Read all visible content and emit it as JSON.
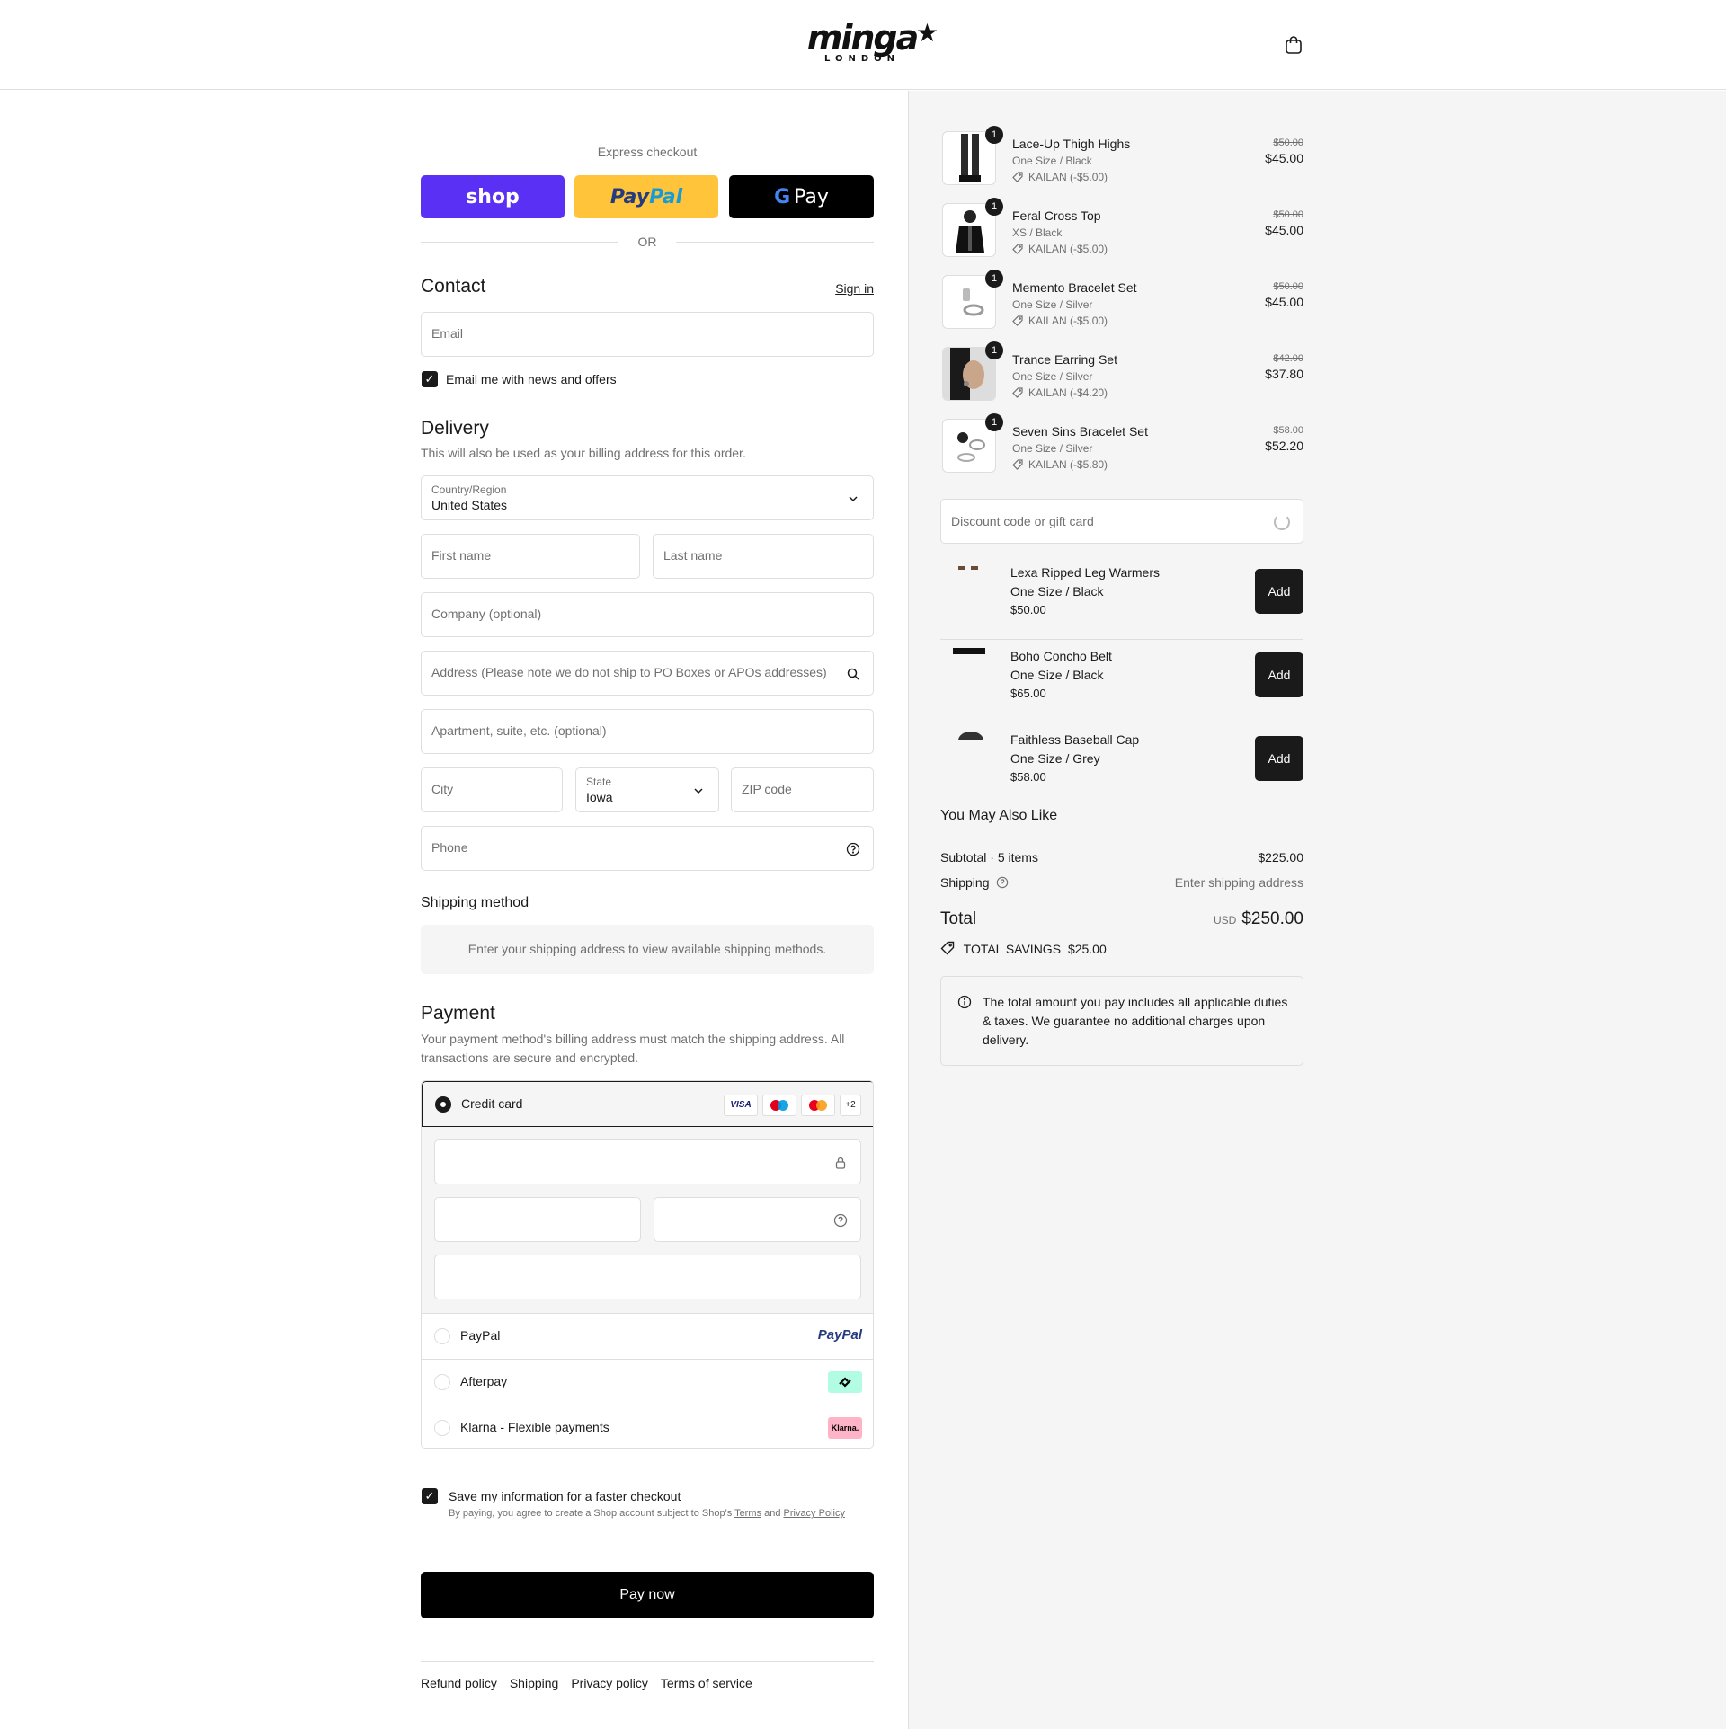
{
  "header": {
    "logo_text": "minga",
    "logo_sub": "LONDON",
    "cart_icon": "shopping-bag-icon"
  },
  "express": {
    "label": "Express checkout",
    "shop_label": "shop",
    "paypal_label_1": "Pay",
    "paypal_label_2": "Pal",
    "gpay_label": "Pay",
    "or": "OR"
  },
  "contact": {
    "title": "Contact",
    "sign_in": "Sign in",
    "email_placeholder": "Email",
    "newsletter_label": "Email me with news and offers",
    "newsletter_checked": true
  },
  "delivery": {
    "title": "Delivery",
    "subtitle": "This will also be used as your billing address for this order.",
    "country_label": "Country/Region",
    "country_value": "United States",
    "first_name": "First name",
    "last_name": "Last name",
    "company": "Company (optional)",
    "address": "Address (Please note we do not ship to PO Boxes or APOs addresses)",
    "apartment": "Apartment, suite, etc. (optional)",
    "city": "City",
    "state_label": "State",
    "state_value": "Iowa",
    "zip": "ZIP code",
    "phone": "Phone"
  },
  "shipping_method": {
    "title": "Shipping method",
    "message": "Enter your shipping address to view available shipping methods."
  },
  "payment": {
    "title": "Payment",
    "subtitle_1": "Your payment method's billing address must match the shipping address. All",
    "subtitle_2": "transactions are secure and encrypted.",
    "credit_card": "Credit card",
    "card_logos": [
      "VISA",
      "maestro",
      "mastercard",
      "+2"
    ],
    "paypal": "PayPal",
    "paypal_logo": "PayPal",
    "afterpay": "Afterpay",
    "klarna": "Klarna - Flexible payments",
    "klarna_logo": "Klarna."
  },
  "save_info": {
    "label": "Save my information for a faster checkout",
    "checked": true,
    "fine_print_1": "By paying, you agree to create a Shop account subject to Shop's",
    "terms": "Terms",
    "and": "and",
    "privacy": "Privacy Policy"
  },
  "pay_now": "Pay now",
  "footer": {
    "links": [
      "Refund policy",
      "Shipping",
      "Privacy policy",
      "Terms of service"
    ]
  },
  "cart": {
    "items": [
      {
        "name": "Lace-Up Thigh Highs",
        "variant": "One Size / Black",
        "discount": "KAILAN (-$5.00)",
        "old_price": "$50.00",
        "price": "$45.00",
        "qty": "1"
      },
      {
        "name": "Feral Cross Top",
        "variant": "XS / Black",
        "discount": "KAILAN (-$5.00)",
        "old_price": "$50.00",
        "price": "$45.00",
        "qty": "1"
      },
      {
        "name": "Memento Bracelet Set",
        "variant": "One Size / Silver",
        "discount": "KAILAN (-$5.00)",
        "old_price": "$50.00",
        "price": "$45.00",
        "qty": "1"
      },
      {
        "name": "Trance Earring Set",
        "variant": "One Size / Silver",
        "discount": "KAILAN (-$4.20)",
        "old_price": "$42.00",
        "price": "$37.80",
        "qty": "1"
      },
      {
        "name": "Seven Sins Bracelet Set",
        "variant": "One Size / Silver",
        "discount": "KAILAN (-$5.80)",
        "old_price": "$58.00",
        "price": "$52.20",
        "qty": "1"
      }
    ],
    "discount_placeholder": "Discount code or gift card",
    "upsells": [
      {
        "name": "Lexa Ripped Leg Warmers",
        "variant": "One Size / Black",
        "price": "$50.00",
        "add": "Add"
      },
      {
        "name": "Boho Concho Belt",
        "variant": "One Size / Black",
        "price": "$65.00",
        "add": "Add"
      },
      {
        "name": "Faithless Baseball Cap",
        "variant": "One Size / Grey",
        "price": "$58.00",
        "add": "Add"
      }
    ],
    "you_may_also_like": "You May Also Like",
    "subtotal_label": "Subtotal · 5 items",
    "subtotal_value": "$225.00",
    "shipping_label": "Shipping",
    "shipping_value": "Enter shipping address",
    "total_label": "Total",
    "total_currency": "USD",
    "total_value": "$250.00",
    "savings_label": "TOTAL SAVINGS",
    "savings_value": "$25.00",
    "notice": "The total amount you pay includes all applicable duties & taxes. We guarantee no additional charges upon delivery."
  }
}
